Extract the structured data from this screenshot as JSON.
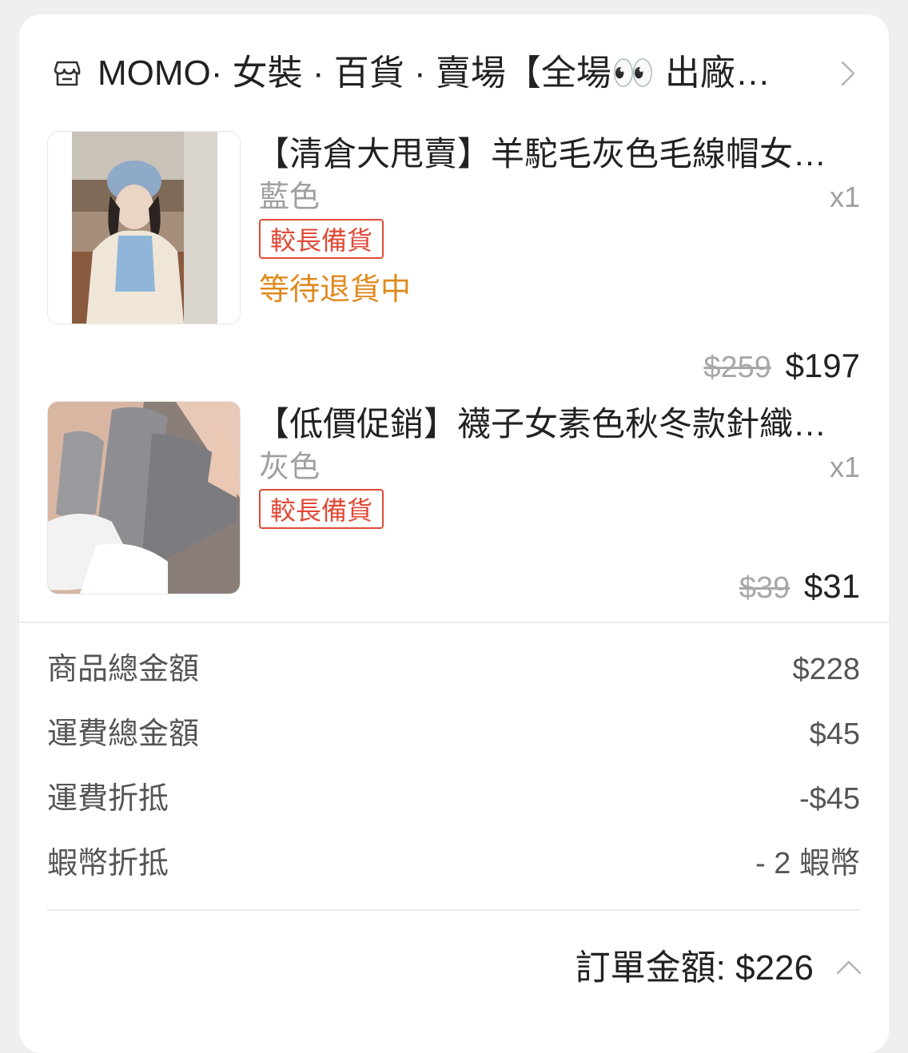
{
  "shop": {
    "name": "MOMO· 女裝 · 百貨 · 賣場【全場👀 出廠…",
    "icon": "shop-icon"
  },
  "items": [
    {
      "title": "【清倉大甩賣】羊駝毛灰色毛線帽女…",
      "variant": "藍色",
      "qty": "x1",
      "tag": "較長備貨",
      "status": "等待退貨中",
      "original_price": "$259",
      "price": "$197"
    },
    {
      "title": "【低價促銷】襪子女素色秋冬款針織…",
      "variant": "灰色",
      "qty": "x1",
      "tag": "較長備貨",
      "original_price": "$39",
      "price": "$31"
    }
  ],
  "summary": {
    "rows": [
      {
        "label": "商品總金額",
        "value": "$228"
      },
      {
        "label": "運費總金額",
        "value": "$45"
      },
      {
        "label": "運費折抵",
        "value": "-$45"
      },
      {
        "label": "蝦幣折抵",
        "value": "- 2 蝦幣"
      }
    ],
    "total_label": "訂單金額: ",
    "total_value": "$226"
  },
  "colors": {
    "tag_red": "#e04a38",
    "status_orange": "#e08a1e",
    "muted_gray": "#a0a0a0"
  }
}
